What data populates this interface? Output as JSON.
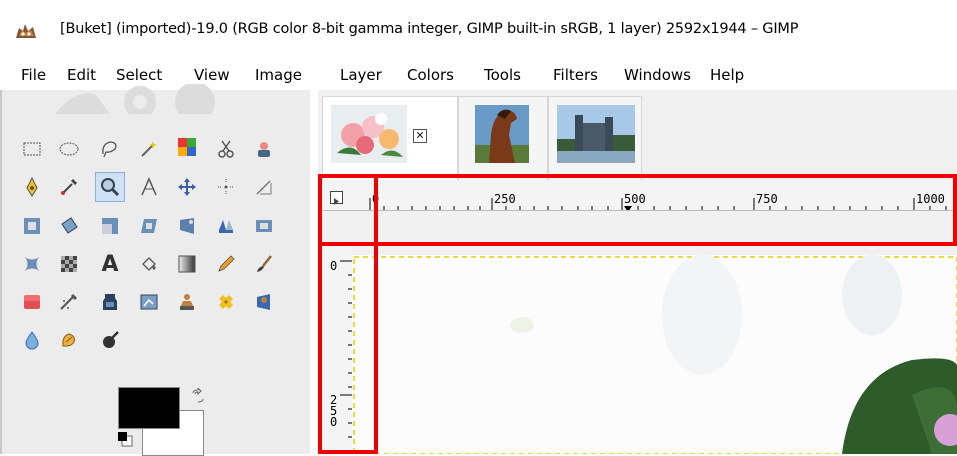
{
  "window": {
    "title": "[Buket] (imported)-19.0 (RGB color 8-bit gamma integer, GIMP built-in sRGB, 1 layer) 2592x1944 – GIMP",
    "app_icon": "gimp-wilber-icon"
  },
  "menubar": {
    "items": [
      {
        "label": "File"
      },
      {
        "label": "Edit"
      },
      {
        "label": "Select"
      },
      {
        "label": "View"
      },
      {
        "label": "Image"
      },
      {
        "label": "Layer"
      },
      {
        "label": "Colors"
      },
      {
        "label": "Tools"
      },
      {
        "label": "Filters"
      },
      {
        "label": "Windows"
      },
      {
        "label": "Help"
      }
    ]
  },
  "toolbox": {
    "tools": [
      "rect-select-icon",
      "ellipse-select-icon",
      "free-select-icon",
      "fuzzy-select-icon",
      "select-by-color-icon",
      "scissors-icon",
      "foreground-select-icon",
      "paths-icon",
      "color-picker-icon",
      "zoom-icon",
      "measure-icon",
      "move-icon",
      "align-icon",
      "crop-icon",
      "unified-transform-icon",
      "rotate-icon",
      "scale-icon",
      "shear-icon",
      "perspective-icon",
      "flip-icon",
      "cage-transform-icon",
      "warp-transform-icon",
      "gradient-checker-icon",
      "text-icon",
      "bucket-fill-icon",
      "blend-icon",
      "pencil-icon",
      "paintbrush-icon",
      "eraser-icon",
      "airbrush-icon",
      "ink-icon",
      "mypaint-brush-icon",
      "clone-icon",
      "heal-icon",
      "perspective-clone-icon",
      "blur-icon",
      "smudge-icon",
      "dodge-burn-icon"
    ],
    "active_tool": "zoom-icon",
    "foreground_color": "#000000",
    "background_color": "#ffffff"
  },
  "image_tabs": [
    {
      "name": "Buket",
      "thumbnail": "flowers-thumbnail",
      "active": true
    },
    {
      "name": "horse",
      "thumbnail": "horse-thumbnail",
      "active": false
    },
    {
      "name": "castle",
      "thumbnail": "castle-thumbnail",
      "active": false
    }
  ],
  "ruler": {
    "top_labels": [
      "0",
      "250",
      "500",
      "750",
      "1000"
    ],
    "left_labels": [
      "0",
      "250"
    ]
  },
  "colors": {
    "highlight": "#ee0000",
    "canvas_border": "#e0d000"
  }
}
